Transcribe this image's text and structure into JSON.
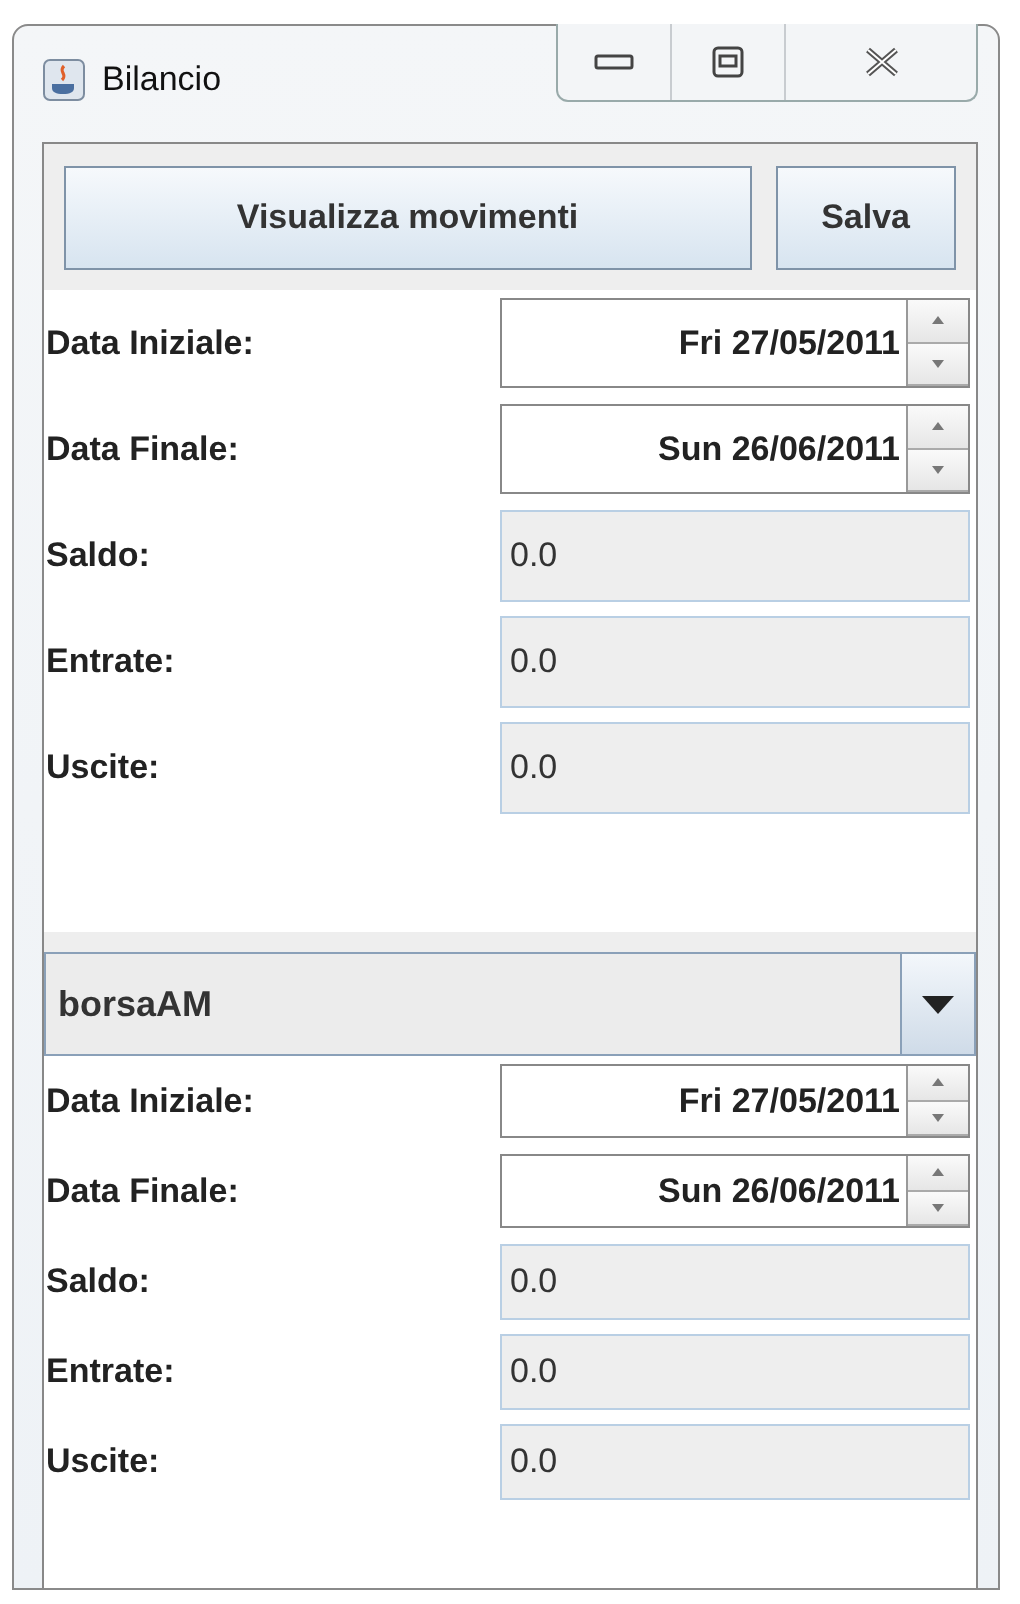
{
  "window": {
    "title": "Bilancio"
  },
  "buttons": [
    "Visualizza movimenti",
    "Salva"
  ],
  "panels": [
    {
      "rows": [
        {
          "label": "Data Iniziale:",
          "kind": "spinner",
          "value": "Fri 27/05/2011"
        },
        {
          "label": "Data Finale:",
          "kind": "spinner",
          "value": "Sun 26/06/2011"
        },
        {
          "label": "Saldo:",
          "kind": "readonly",
          "value": "0.0"
        },
        {
          "label": "Entrate:",
          "kind": "readonly",
          "value": "0.0"
        },
        {
          "label": "Uscite:",
          "kind": "readonly",
          "value": "0.0"
        }
      ]
    },
    {
      "combo": {
        "value": "borsaAM"
      },
      "rows": [
        {
          "label": "Data Iniziale:",
          "kind": "spinner",
          "value": "Fri 27/05/2011"
        },
        {
          "label": "Data Finale:",
          "kind": "spinner",
          "value": "Sun 26/06/2011"
        },
        {
          "label": "Saldo:",
          "kind": "readonly",
          "value": "0.0"
        },
        {
          "label": "Entrate:",
          "kind": "readonly",
          "value": "0.0"
        },
        {
          "label": "Uscite:",
          "kind": "readonly",
          "value": "0.0"
        }
      ]
    }
  ]
}
